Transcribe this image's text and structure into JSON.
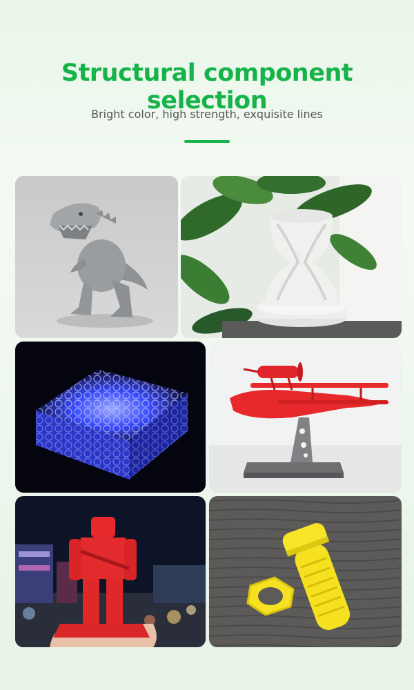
{
  "header": {
    "title": "Structural component selection",
    "subtitle": "Bright color, high strength, exquisite lines"
  },
  "colors": {
    "accent": "#17b34a",
    "subtitle_text": "#555555",
    "gray_model": "#9a9da0",
    "white_model": "#f0f0ee",
    "blue_glow": "#3a4cff",
    "red_model": "#e8292c",
    "yellow_model": "#f5e11f"
  },
  "gallery": [
    {
      "name": "gray-dinosaur-print"
    },
    {
      "name": "white-hourglass-vase-print"
    },
    {
      "name": "blue-glowing-lattice-block-print"
    },
    {
      "name": "red-seaplane-model-print"
    },
    {
      "name": "red-robot-figure-print"
    },
    {
      "name": "yellow-bolt-and-nut-print"
    }
  ]
}
